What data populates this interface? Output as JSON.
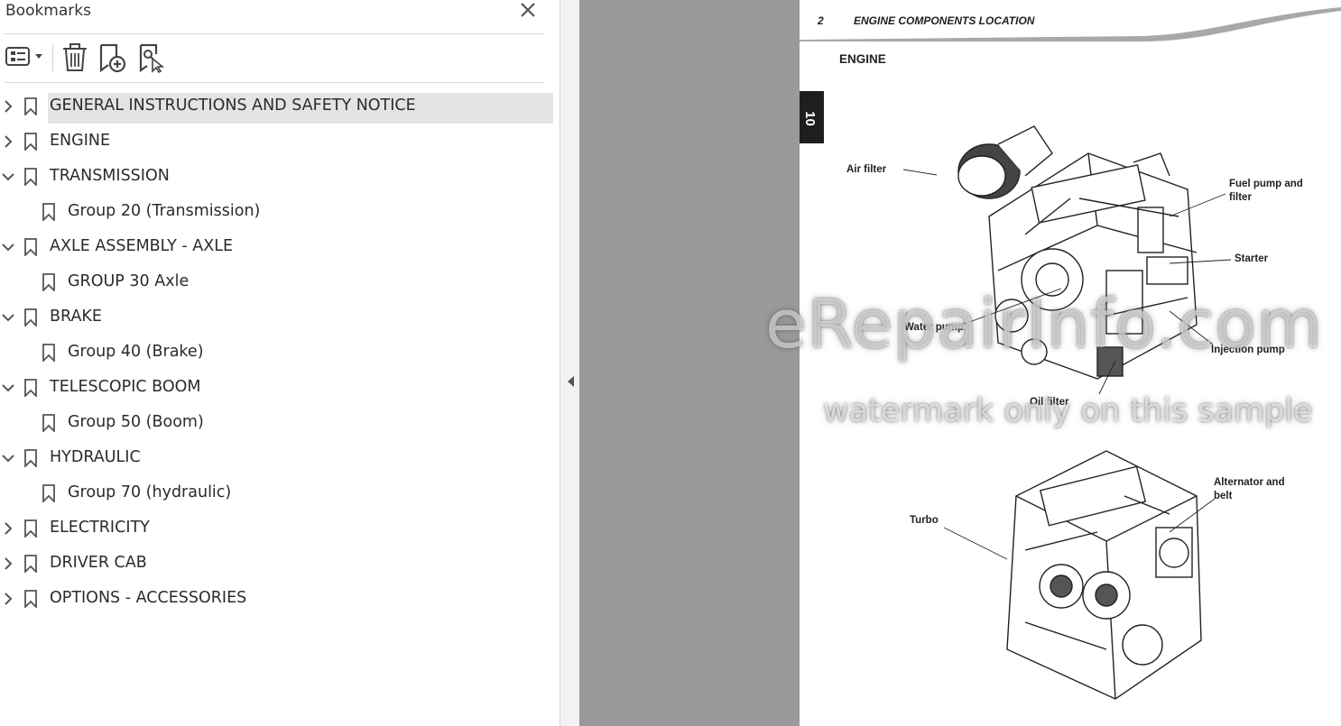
{
  "panel": {
    "title": "Bookmarks",
    "toolbar": {
      "options_icon": "list-options-icon",
      "delete_icon": "trash-icon",
      "new_bookmark_icon": "new-bookmark-icon",
      "find_bookmark_icon": "find-current-bookmark-icon"
    }
  },
  "bookmarks": [
    {
      "label": "GENERAL INSTRUCTIONS AND SAFETY NOTICE",
      "level": 0,
      "state": "collapsed",
      "selected": true
    },
    {
      "label": "ENGINE",
      "level": 0,
      "state": "collapsed"
    },
    {
      "label": "TRANSMISSION",
      "level": 0,
      "state": "expanded"
    },
    {
      "label": "Group 20 (Transmission)",
      "level": 1
    },
    {
      "label": "AXLE ASSEMBLY - AXLE",
      "level": 0,
      "state": "expanded"
    },
    {
      "label": "GROUP 30 Axle",
      "level": 1
    },
    {
      "label": "BRAKE",
      "level": 0,
      "state": "expanded"
    },
    {
      "label": "Group 40 (Brake)",
      "level": 1
    },
    {
      "label": "TELESCOPIC BOOM",
      "level": 0,
      "state": "expanded"
    },
    {
      "label": "Group 50 (Boom)",
      "level": 1
    },
    {
      "label": "HYDRAULIC",
      "level": 0,
      "state": "expanded"
    },
    {
      "label": "Group 70 (hydraulic)",
      "level": 1
    },
    {
      "label": "ELECTRICITY",
      "level": 0,
      "state": "collapsed"
    },
    {
      "label": "DRIVER CAB",
      "level": 0,
      "state": "collapsed"
    },
    {
      "label": "OPTIONS - ACCESSORIES",
      "level": 0,
      "state": "collapsed"
    }
  ],
  "page": {
    "header_number": "2",
    "header_title": "ENGINE COMPONENTS LOCATION",
    "section_title": "ENGINE",
    "tab_number": "10",
    "callouts": {
      "air_filter": "Air filter",
      "fuel_pump_line1": "Fuel pump and",
      "fuel_pump_line2": "filter",
      "starter": "Starter",
      "water_pump": "Water pump",
      "injection_pump": "Injection pump",
      "oil_filter": "Oil filter",
      "alternator_line1": "Alternator and",
      "alternator_line2": "belt",
      "turbo": "Turbo"
    },
    "watermark_main": "eRepairInfo.com",
    "watermark_sub": "watermark only on this sample"
  },
  "colors": {
    "selection": "#e4e4e4",
    "doc_background": "#9a9a9a",
    "tab_box": "#1e1e1e"
  }
}
